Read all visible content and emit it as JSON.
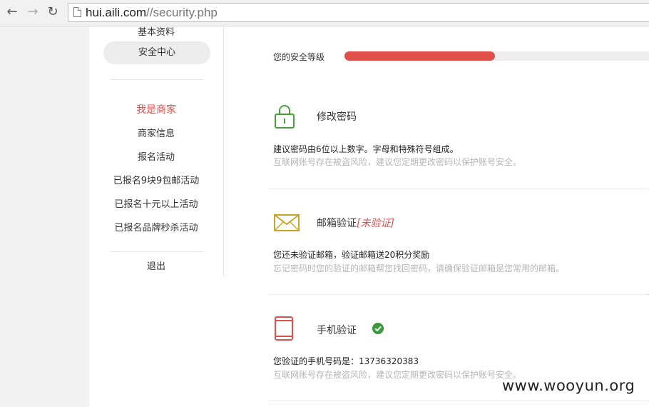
{
  "browser": {
    "url_host": "hui.aili.com",
    "url_path": "//security.php",
    "back_icon": "back-arrow-icon",
    "forward_icon": "forward-arrow-icon",
    "reload_icon": "reload-icon"
  },
  "sidebar": {
    "top_link": "基本资料",
    "active_link": "安全中心",
    "merchant_heading": "我是商家",
    "merchant_links": [
      "商家信息",
      "报名活动",
      "已报名9块9包邮活动",
      "已报名十元以上活动",
      "已报名品牌秒杀活动"
    ],
    "logout": "退出"
  },
  "security": {
    "level_label": "您的安全等级",
    "level_fraction": 0.49,
    "level_color": "#e0504b",
    "items": [
      {
        "icon": "lock-icon",
        "title": "修改密码",
        "desc": "建议密码由6位以上数字。字母和特殊符号组成。",
        "hint": "互联网账号存在被盗风险，建议您定期更改密码以保护账号安全。"
      },
      {
        "icon": "envelope-icon",
        "title": "邮箱验证",
        "status": "[未验证]",
        "desc": "您还未验证邮箱，验证邮箱送20积分奖励",
        "hint": "忘记密码时您的验证的邮箱帮您找回密码，请确保验证邮箱是您常用的邮箱。"
      },
      {
        "icon": "mobile-phone-icon",
        "title": "手机验证",
        "status_icon": "verified-check-icon",
        "desc": "您验证的手机号码是：13736320383",
        "hint": "互联网账号存在被盗风险，建议您定期更改密码以保护账号安全。"
      }
    ]
  },
  "watermark": "www.wooyun.org"
}
